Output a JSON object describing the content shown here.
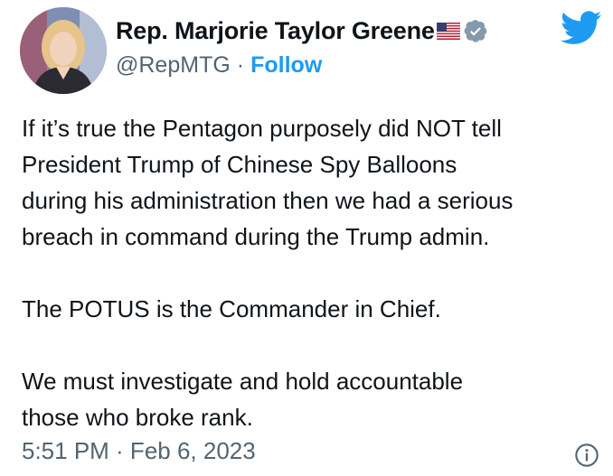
{
  "author": {
    "display_name": "Rep. Marjorie Taylor Greene",
    "flag_icon": "us-flag-icon",
    "verified_icon": "verified-badge-icon",
    "handle": "@RepMTG",
    "separator": "·",
    "follow_label": "Follow"
  },
  "tweet": {
    "paragraphs": [
      "If it’s true the Pentagon purposely did NOT tell\nPresident Trump of Chinese Spy Balloons\nduring his administration then we had a serious\nbreach in command during the Trump admin.",
      "The POTUS is the Commander in Chief.",
      "We must investigate and hold accountable\nthose who broke rank."
    ],
    "timestamp": "5:51 PM · Feb 6, 2023"
  },
  "icons": {
    "brand": "twitter-bird-icon",
    "info": "info-icon"
  },
  "colors": {
    "brand_blue": "#1d9bf0",
    "secondary_text": "#536471",
    "primary_text": "#0f1419",
    "verified_gray": "#829aab"
  }
}
